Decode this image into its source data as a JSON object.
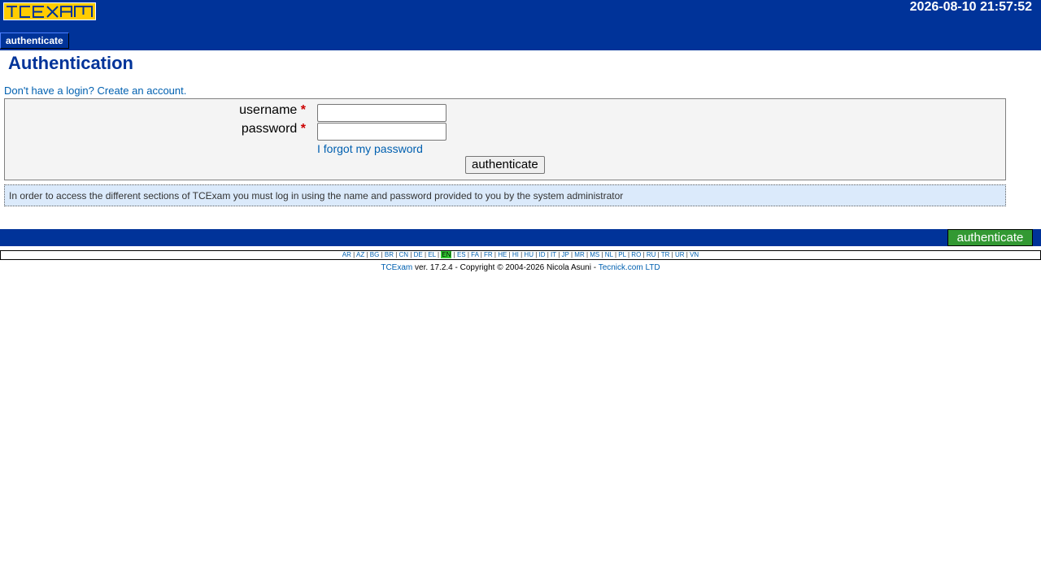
{
  "header": {
    "logo_text": "TCEXAM",
    "datetime": "2026-08-10 21:57:52",
    "menu_tab": "authenticate"
  },
  "page": {
    "title": "Authentication",
    "create_account_link": "Don't have a login? Create an account."
  },
  "form": {
    "username_label": "username",
    "password_label": "password",
    "required_mark": "*",
    "username_value": "",
    "password_value": "",
    "forgot_link": "I forgot my password",
    "submit_label": "authenticate"
  },
  "help_text": "In order to access the different sections of TCExam you must log in using the name and password provided to you by the system administrator",
  "bottom_bar": {
    "auth_label": "authenticate"
  },
  "languages": {
    "items": [
      "AR",
      "AZ",
      "BG",
      "BR",
      "CN",
      "DE",
      "EL",
      "EN",
      "ES",
      "FA",
      "FR",
      "HE",
      "HI",
      "HU",
      "ID",
      "IT",
      "JP",
      "MR",
      "MS",
      "NL",
      "PL",
      "RO",
      "RU",
      "TR",
      "UR",
      "VN"
    ],
    "selected": "EN"
  },
  "footer": {
    "app_link": "TCExam",
    "version_text": " ver. 17.2.4 - Copyright © 2004-2026 Nicola Asuni - ",
    "company_link": "Tecnick.com LTD"
  },
  "colors": {
    "header_bg": "#003399",
    "title": "#003399",
    "link": "#0060b0",
    "logo": "#ffcc00",
    "active_green": "#339933",
    "help_bg": "#dbeafb"
  }
}
